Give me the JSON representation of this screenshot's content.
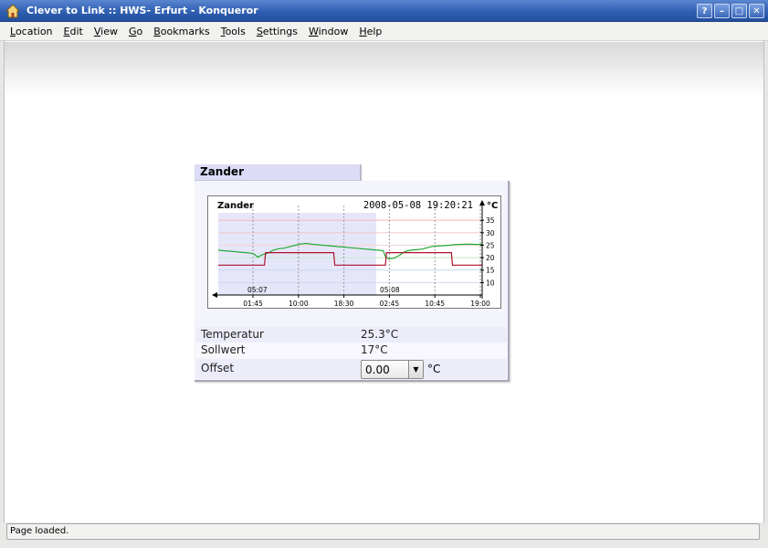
{
  "window": {
    "title": "Clever to Link :: HWS- Erfurt - Konqueror",
    "buttons": [
      "?",
      "–",
      "□",
      "✕"
    ]
  },
  "menubar": {
    "items": [
      {
        "label": "Location",
        "accel": "L",
        "rest": "ocation"
      },
      {
        "label": "Edit",
        "accel": "E",
        "rest": "dit"
      },
      {
        "label": "View",
        "accel": "V",
        "rest": "iew"
      },
      {
        "label": "Go",
        "accel": "G",
        "rest": "o"
      },
      {
        "label": "Bookmarks",
        "accel": "B",
        "rest": "ookmarks"
      },
      {
        "label": "Tools",
        "accel": "T",
        "rest": "ools"
      },
      {
        "label": "Settings",
        "accel": "S",
        "rest": "ettings"
      },
      {
        "label": "Window",
        "accel": "W",
        "rest": "indow"
      },
      {
        "label": "Help",
        "accel": "H",
        "rest": "elp"
      }
    ]
  },
  "widget": {
    "tab_title": "Zander",
    "rows": [
      {
        "label": "Temperatur",
        "value": "25.3°C"
      },
      {
        "label": "Sollwert",
        "value": "17°C"
      },
      {
        "label": "Offset",
        "value": ""
      }
    ],
    "offset_value": "0.00",
    "offset_unit": "°C"
  },
  "chart_data": {
    "type": "line",
    "title": "Zander",
    "timestamp": "2008-05-08 19:20:21",
    "ylabel": "°C",
    "ylim": [
      5,
      38
    ],
    "yticks": [
      10,
      15,
      20,
      25,
      30,
      35
    ],
    "xticks": [
      "01:45",
      "10:00",
      "18:30",
      "02:45",
      "10:45",
      "19:00"
    ],
    "day_labels": [
      "05:07",
      "05:08"
    ],
    "series": [
      {
        "color": "#22aa33",
        "x": [
          0,
          0.5,
          1,
          1.5,
          2,
          2.5,
          3,
          3.3,
          3.6,
          4,
          4.5,
          5,
          5.5,
          6,
          6.5,
          7,
          7.5,
          8,
          8.5,
          9,
          9.5,
          10,
          10.5,
          11,
          11.5,
          12,
          12.5,
          13,
          13.5,
          14,
          14.5,
          15,
          15.2,
          15.5,
          16,
          16.5,
          17,
          17.5,
          18,
          18.5,
          19,
          19.5,
          20,
          20.5,
          21,
          21.5,
          22,
          22.5,
          23,
          23.5,
          24
        ],
        "y": [
          23,
          22.8,
          22.6,
          22.4,
          22.2,
          22,
          21.8,
          21.3,
          20.2,
          21.2,
          21.8,
          23,
          23.6,
          23.8,
          24.4,
          25,
          25.5,
          25.7,
          25.4,
          25.2,
          25,
          24.8,
          24.6,
          24.4,
          24.2,
          24,
          23.8,
          23.6,
          23.4,
          23.2,
          23,
          22.8,
          20.5,
          19.5,
          19.8,
          21,
          22.5,
          23,
          23.2,
          23.4,
          24,
          24.5,
          24.7,
          24.8,
          25,
          25.2,
          25.3,
          25.4,
          25.4,
          25.3,
          25.3
        ]
      },
      {
        "color": "#b0102a",
        "x": [
          0,
          4.2,
          4.3,
          10.5,
          10.6,
          15.2,
          15.3,
          21.2,
          21.3,
          24
        ],
        "y": [
          17,
          17,
          22,
          22,
          17,
          17,
          22,
          22,
          17,
          17
        ]
      }
    ],
    "grid": true
  },
  "status": {
    "text": "Page loaded."
  }
}
